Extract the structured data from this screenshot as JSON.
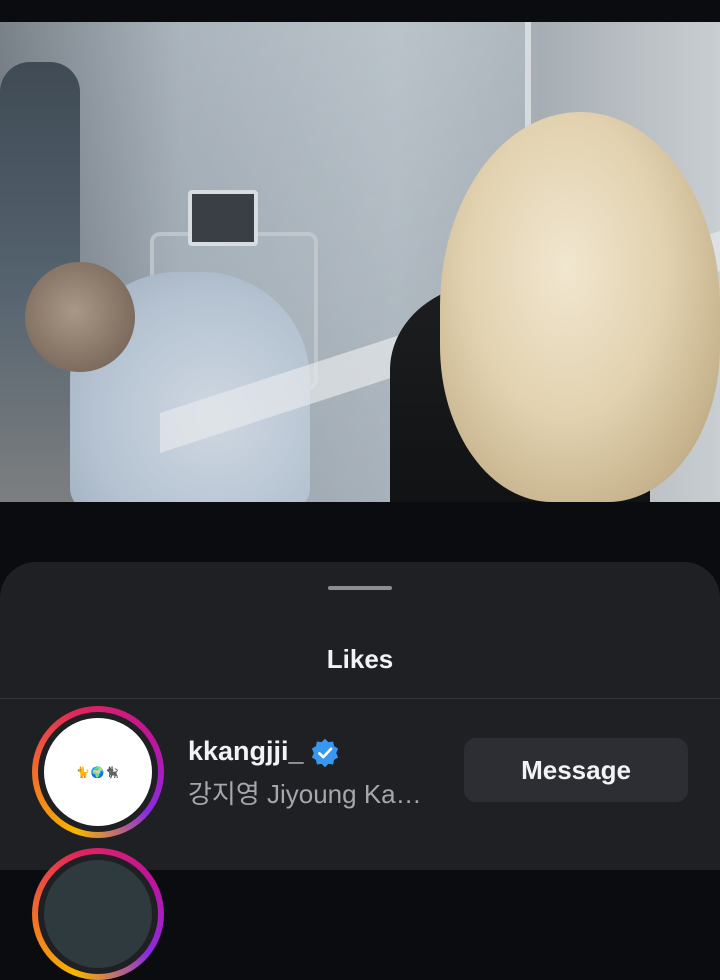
{
  "sheet": {
    "title": "Likes"
  },
  "likes": [
    {
      "username": "kkangjji_",
      "verified": true,
      "full_name": "강지영 Jiyoung Ka…",
      "avatar_emoji": "🐈🌍🐈‍⬛",
      "action_label": "Message"
    }
  ],
  "colors": {
    "sheet_bg": "#1f2024",
    "button_bg": "#2c2e33",
    "verified_badge": "#3897f0"
  }
}
